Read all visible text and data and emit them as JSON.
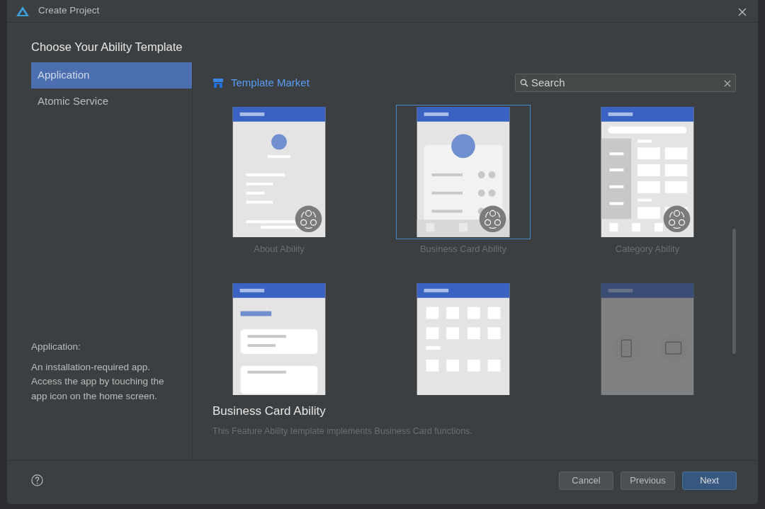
{
  "window": {
    "title": "Create Project"
  },
  "heading": "Choose Your Ability Template",
  "sidebar": {
    "items": [
      {
        "label": "Application",
        "selected": true
      },
      {
        "label": "Atomic Service",
        "selected": false
      }
    ],
    "description": {
      "title": "Application:",
      "text": "An installation-required app. Access the app by touching the app icon on the home screen."
    }
  },
  "template_market": {
    "label": "Template Market"
  },
  "search": {
    "placeholder": "Search"
  },
  "templates": [
    {
      "kind": "about",
      "label": "About Ability",
      "selected": false,
      "disabled": false
    },
    {
      "kind": "business-card",
      "label": "Business Card Ability",
      "selected": true,
      "disabled": false
    },
    {
      "kind": "category",
      "label": "Category Ability",
      "selected": false,
      "disabled": false
    },
    {
      "kind": "list",
      "selected": false,
      "disabled": false
    },
    {
      "kind": "grid",
      "selected": false,
      "disabled": false
    },
    {
      "kind": "devices",
      "selected": false,
      "disabled": true
    }
  ],
  "detail": {
    "title": "Business Card Ability",
    "text": "This Feature Ability template implements Business Card functions."
  },
  "buttons": [
    {
      "label": "Cancel",
      "primary": false
    },
    {
      "label": "Previous",
      "primary": false
    },
    {
      "label": "Next",
      "primary": true
    }
  ]
}
